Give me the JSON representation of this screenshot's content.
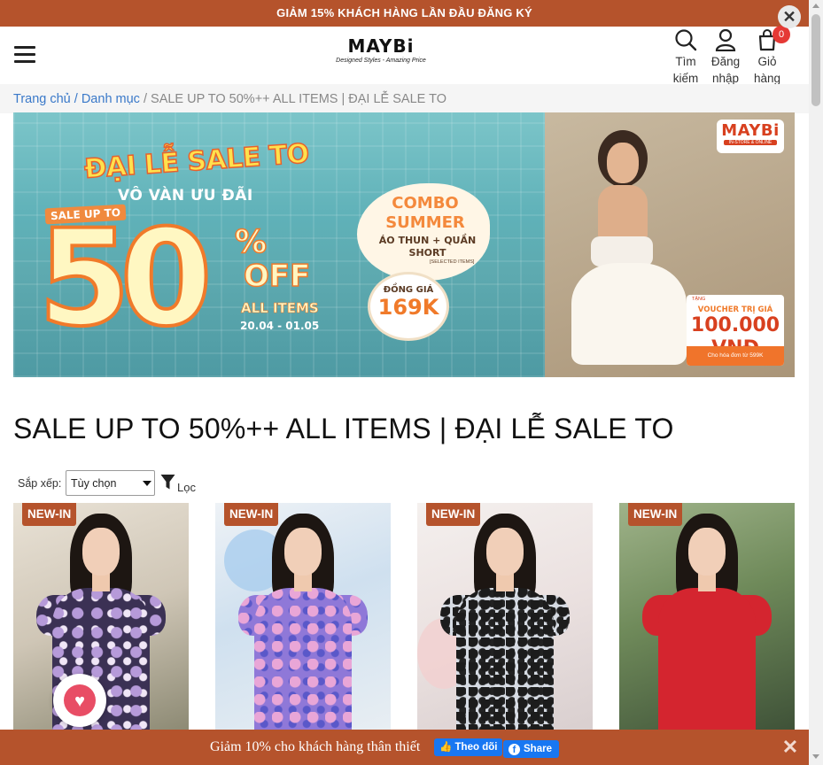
{
  "promo": {
    "text": "GIẢM 15% KHÁCH HÀNG LẦN ĐẦU ĐĂNG KÝ",
    "close": "✕"
  },
  "header": {
    "logo": {
      "name": "MAYBi",
      "tagline": "Designed Styles - Amazing Price"
    },
    "search": {
      "line1": "Tìm",
      "line2": "kiếm"
    },
    "login": {
      "line1": "Đăng",
      "line2": "nhập"
    },
    "cart": {
      "line1": "Giỏ",
      "line2": "hàng",
      "count": "0"
    }
  },
  "breadcrumb": {
    "home": "Trang chủ",
    "category": "/ Danh mục",
    "current": "/ SALE UP TO 50%++ ALL ITEMS | ĐẠI LỄ SALE TO"
  },
  "banner": {
    "title": "ĐẠI LỄ SALE TO",
    "subtitle": "VÔ VÀN ƯU ĐÃI",
    "sale_up_to": "SALE UP TO",
    "big_number": "50",
    "percent": "%",
    "off": "OFF",
    "all_items": "ALL ITEMS",
    "dates": "20.04 - 01.05",
    "combo_title": "COMBO SUMMER",
    "combo_items": "ÁO THUN + QUẦN SHORT",
    "combo_note": "[SELECTED ITEMS]",
    "price_label": "ĐỒNG GIÁ",
    "price_value": "169K",
    "logo_name": "MAYBi",
    "logo_sub": "IN-STORE & ONLINE",
    "voucher_tag": "TẶNG",
    "voucher_title": "VOUCHER TRỊ GIÁ",
    "voucher_value": "100.000 VNĐ",
    "voucher_note": "Cho hóa đơn từ 599K"
  },
  "page_title": "SALE UP TO 50%++ ALL ITEMS | ĐẠI LỄ SALE TO",
  "toolbar": {
    "sort_label": "Sắp xếp:",
    "sort_value": "Tùy chọn",
    "filter_label": "Lọc"
  },
  "products": [
    {
      "badge": "NEW-IN"
    },
    {
      "badge": "NEW-IN"
    },
    {
      "badge": "NEW-IN"
    },
    {
      "badge": "NEW-IN"
    }
  ],
  "footer_bar": {
    "text": "Giảm 10% cho khách hàng thân thiết",
    "follow": "Theo dõi",
    "share": "Share",
    "close": "✕"
  },
  "colors": {
    "brand": "#b5532c",
    "link": "#3a79c9",
    "badge_red": "#e53935",
    "facebook": "#1877f2"
  }
}
